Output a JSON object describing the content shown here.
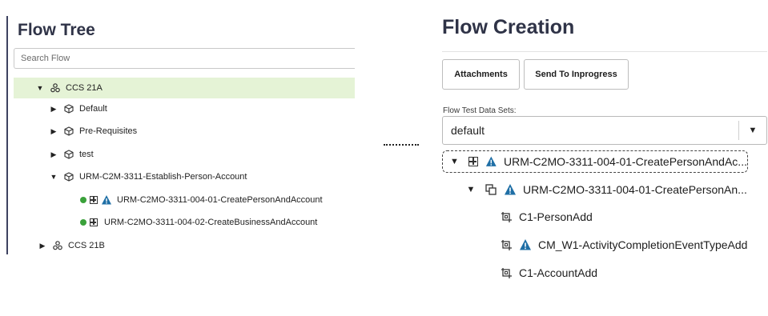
{
  "flow_tree": {
    "title": "Flow Tree",
    "search_placeholder": "Search Flow",
    "items": [
      {
        "label": "CCS 21A",
        "icon": "cluster-icon",
        "expanded": true,
        "selected": true
      },
      {
        "label": "Default",
        "icon": "package-icon",
        "expanded": false
      },
      {
        "label": "Pre-Requisites",
        "icon": "package-icon",
        "expanded": false
      },
      {
        "label": "test",
        "icon": "package-icon",
        "expanded": false
      },
      {
        "label": "URM-C2M-3311-Establish-Person-Account",
        "icon": "package-icon",
        "expanded": true
      },
      {
        "label": "URM-C2MO-3311-004-01-CreatePersonAndAccount",
        "status_color": "#3aa13a",
        "warning": true
      },
      {
        "label": "URM-C2MO-3311-004-02-CreateBusinessAndAccount",
        "status_color": "#3aa13a",
        "warning": false
      },
      {
        "label": "CCS 21B",
        "icon": "cluster-icon",
        "expanded": false
      }
    ]
  },
  "flow_creation": {
    "title": "Flow Creation",
    "attachments_label": "Attachments",
    "send_label": "Send To Inprogress",
    "datasets_label": "Flow Test Data Sets:",
    "dataset_value": "default",
    "tree": [
      {
        "label": "URM-C2MO-3311-004-01-CreatePersonAndAc...",
        "warning": true
      },
      {
        "label": "URM-C2MO-3311-004-01-CreatePersonAn...",
        "warning": true
      },
      {
        "label": "C1-PersonAdd",
        "warning": false
      },
      {
        "label": "CM_W1-ActivityCompletionEventTypeAdd",
        "warning": true
      },
      {
        "label": "C1-AccountAdd",
        "warning": false
      }
    ]
  },
  "colors": {
    "selected_row_bg": "#e5f3d6",
    "title_color": "#2f3347",
    "warning_color": "#1f6fa6",
    "status_green": "#3aa13a"
  }
}
